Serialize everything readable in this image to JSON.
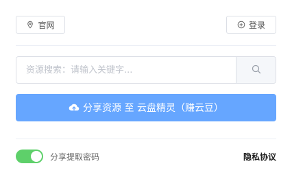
{
  "header": {
    "site_label": "官网",
    "login_label": "登录"
  },
  "search": {
    "placeholder": "资源搜索：请输入关键字...",
    "value": ""
  },
  "share_button": {
    "label": "分享资源 至 云盘精灵（赚云豆）"
  },
  "footer": {
    "toggle_label": "分享提取密码",
    "toggle_on": true,
    "privacy_label": "隐私协议"
  },
  "colors": {
    "primary": "#66a6ff",
    "toggle_on": "#5ed06a",
    "border": "#dcdfe6"
  },
  "icons": {
    "site": "location-pin-icon",
    "login": "plus-circle-icon",
    "search": "search-icon",
    "share": "cloud-upload-icon"
  }
}
